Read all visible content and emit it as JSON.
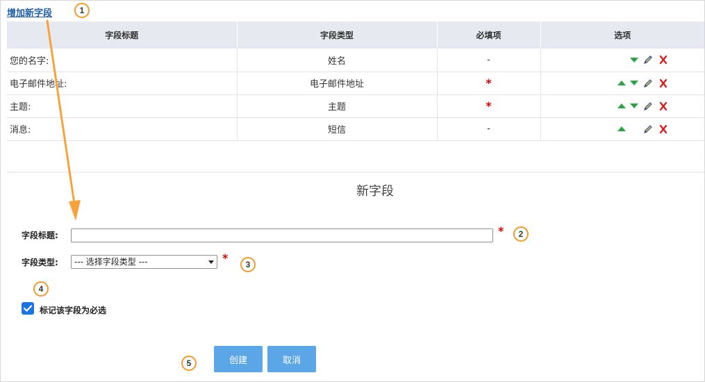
{
  "add_field_link": "增加新字段",
  "table": {
    "headers": [
      "字段标题",
      "字段类型",
      "必填项",
      "选项"
    ],
    "rows": [
      {
        "title": "您的名字:",
        "type": "姓名",
        "required": "-"
      },
      {
        "title": "电子邮件地址:",
        "type": "电子邮件地址",
        "required": "*"
      },
      {
        "title": "主题:",
        "type": "主题",
        "required": "*"
      },
      {
        "title": "消息:",
        "type": "短信",
        "required": "-"
      }
    ]
  },
  "new_field": {
    "title": "新字段",
    "field_title_label": "字段标题:",
    "field_type_label": "字段类型:",
    "field_title_value": "",
    "select_value": "--- 选择字段类型 ---",
    "required_star": "*",
    "checkbox_label": "标记该字段为必选",
    "create_label": "创建",
    "cancel_label": "取消"
  },
  "callouts": [
    "1",
    "2",
    "3",
    "4",
    "5"
  ],
  "icons": {
    "move_up": "triangle-up-icon",
    "move_down": "triangle-down-icon",
    "edit": "pencil-icon",
    "delete": "delete-x-icon"
  },
  "colors": {
    "link": "#1f5fa8",
    "header_bg": "#e6e9ef",
    "required": "#e00000",
    "move_arrows": "#2aa345",
    "button": "#5aa6e6",
    "callout_border": "#f39a2b",
    "annotation_arrow": "#f7a23a"
  }
}
